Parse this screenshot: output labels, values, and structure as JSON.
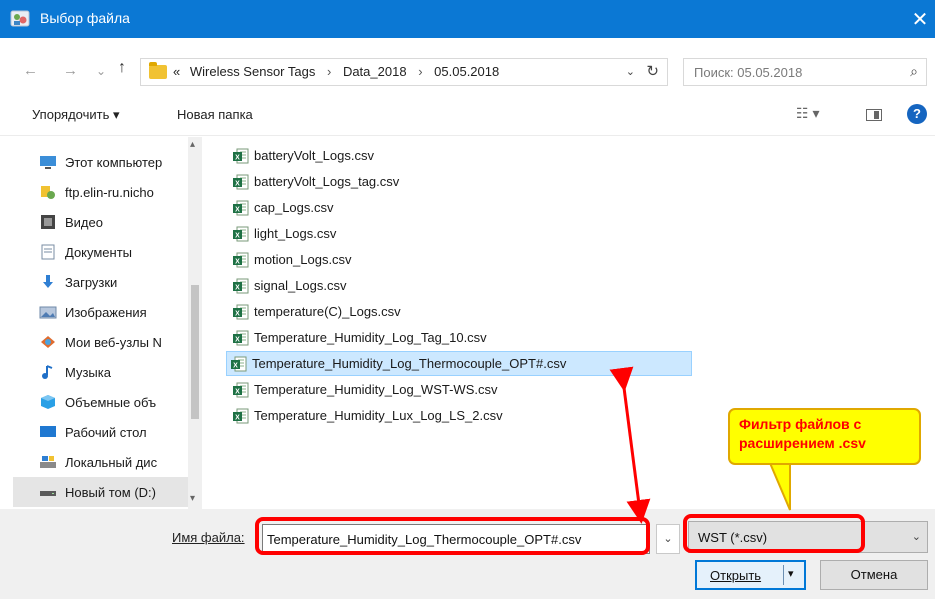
{
  "window": {
    "title": "Выбор файла",
    "close_glyph": "✕"
  },
  "address": {
    "back": "←",
    "forward": "→",
    "history": "⌄",
    "up": "↑",
    "overflow": "«",
    "crumbs": [
      "Wireless Sensor Tags",
      "Data_2018",
      "05.05.2018"
    ],
    "separator": "›",
    "dropdown": "⌄",
    "refresh": "↻"
  },
  "search": {
    "placeholder": "Поиск: 05.05.2018",
    "icon": "⌕"
  },
  "toolbar": {
    "sort_label": "Упорядочить ▾",
    "new_folder_label": "Новая папка",
    "view_label": "☷ ▾",
    "help_label": "?"
  },
  "nav": {
    "items": [
      {
        "label": "Этот компьютер",
        "icon": "pc-icon"
      },
      {
        "label": "ftp.elin-ru.nicho",
        "icon": "network-location-icon"
      },
      {
        "label": "Видео",
        "icon": "video-icon"
      },
      {
        "label": "Документы",
        "icon": "documents-icon"
      },
      {
        "label": "Загрузки",
        "icon": "downloads-icon"
      },
      {
        "label": "Изображения",
        "icon": "pictures-icon"
      },
      {
        "label": "Мои веб-узлы N",
        "icon": "web-sites-icon"
      },
      {
        "label": "Музыка",
        "icon": "music-icon"
      },
      {
        "label": "Объемные объ",
        "icon": "3d-objects-icon"
      },
      {
        "label": "Рабочий стол",
        "icon": "desktop-icon"
      },
      {
        "label": "Локальный дис",
        "icon": "local-disk-icon"
      },
      {
        "label": "Новый том (D:)",
        "icon": "drive-icon"
      }
    ],
    "selected_index": 11,
    "scroll_up": "▴",
    "scroll_down": "▾"
  },
  "files": {
    "items": [
      "batteryVolt_Logs.csv",
      "batteryVolt_Logs_tag.csv",
      "cap_Logs.csv",
      "light_Logs.csv",
      "motion_Logs.csv",
      "signal_Logs.csv",
      "temperature(C)_Logs.csv",
      "Temperature_Humidity_Log_Tag_10.csv",
      "Temperature_Humidity_Log_Thermocouple_OPT#.csv",
      "Temperature_Humidity_Log_WST-WS.csv",
      "Temperature_Humidity_Lux_Log_LS_2.csv"
    ],
    "selected_index": 8
  },
  "bottom": {
    "filename_label": "Имя файла:",
    "filename_value": "Temperature_Humidity_Log_Thermocouple_OPT#.csv",
    "filename_dropdown": "⌄",
    "filter_value": "WST (*.csv)",
    "filter_dropdown": "⌄",
    "open_label": "Открыть",
    "open_arrow": "▾",
    "cancel_label": "Отмена"
  },
  "annotation": {
    "callout_text": "Фильтр файлов с расширением .csv",
    "color": "#ff0000",
    "callout_bg": "#ffff00"
  },
  "colors": {
    "titlebar": "#0b78d4",
    "selection": "#cce8ff",
    "accent": "#0078d7"
  }
}
